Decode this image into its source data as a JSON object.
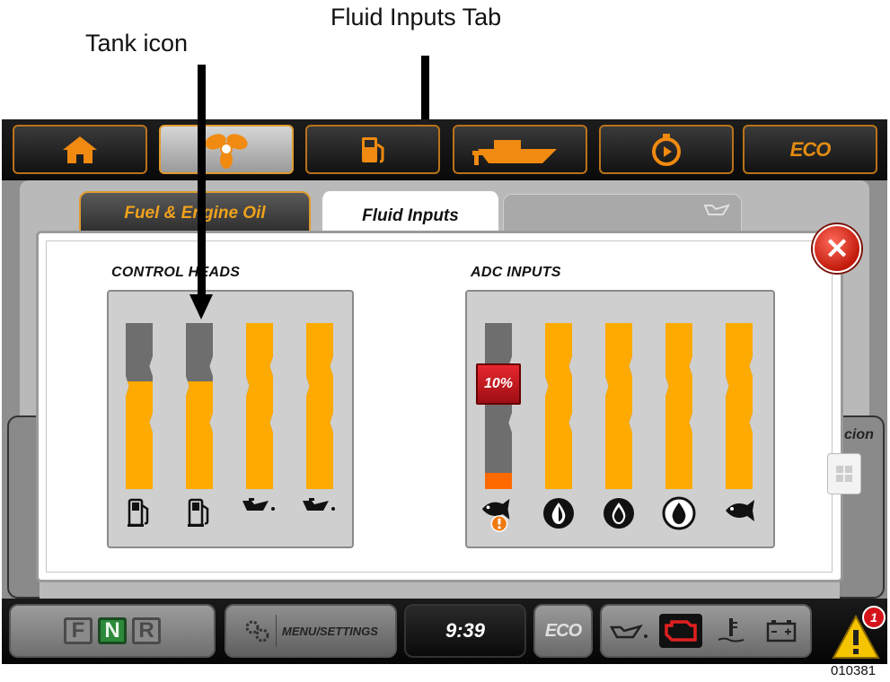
{
  "annotations": {
    "fluid_inputs_tab": "Fluid Inputs Tab",
    "tank_icon": "Tank icon"
  },
  "top_nav": {
    "items": [
      {
        "icon": "home-icon"
      },
      {
        "icon": "propeller-icon",
        "active": true
      },
      {
        "icon": "fuel-pump-icon"
      },
      {
        "icon": "boat-icon"
      },
      {
        "icon": "timer-icon"
      },
      {
        "icon": "eco-icon",
        "label": "ECO"
      }
    ]
  },
  "tabs": {
    "fuel_engine_oil": "Fuel & Engine Oil",
    "fluid_inputs": "Fluid Inputs"
  },
  "side_peek_text": "cion",
  "control_heads": {
    "title": "CONTROL HEADS",
    "tanks": [
      {
        "level": 0.65,
        "icon": "fuel-pump-icon"
      },
      {
        "level": 0.65,
        "icon": "fuel-pump-icon"
      },
      {
        "level": 1.0,
        "icon": "oil-can-icon"
      },
      {
        "level": 1.0,
        "icon": "oil-can-icon"
      }
    ]
  },
  "adc_inputs": {
    "title": "ADC INPUTS",
    "tanks": [
      {
        "level": 0.1,
        "alert": "10%",
        "icon": "fish-alert-icon"
      },
      {
        "level": 1.0,
        "icon": "fresh-water-icon"
      },
      {
        "level": 1.0,
        "icon": "gray-water-icon"
      },
      {
        "level": 1.0,
        "icon": "black-water-icon"
      },
      {
        "level": 1.0,
        "icon": "fish-icon"
      }
    ]
  },
  "bottom_bar": {
    "fnr": [
      "F",
      "N",
      "R"
    ],
    "fnr_active": "N",
    "menu_label": "MENU/SETTINGS",
    "time": "9:39",
    "eco_label": "ECO",
    "warning_count": "1"
  },
  "figure_number": "010381",
  "colors": {
    "tank_fill": "#ffaa00",
    "tank_empty": "#6e6e6e",
    "tank_low": "#ff6a00",
    "accent": "#e09a30",
    "alert_red": "#c8141e",
    "fnr_active": "#2d8a3a"
  }
}
